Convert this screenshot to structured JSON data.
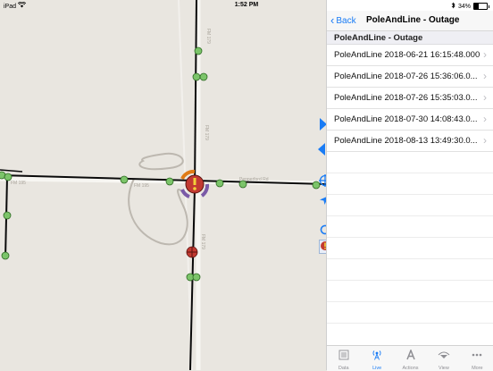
{
  "status_bar": {
    "device": "iPad",
    "time": "1:52 PM",
    "battery": "34%"
  },
  "map": {
    "road_labels": [
      "FM 179",
      "FM 179",
      "FM 179",
      "FM 195",
      "FM 195",
      "Pepperford Rd"
    ]
  },
  "panel": {
    "back_label": "Back",
    "title": "PoleAndLine - Outage",
    "section_header": "PoleAndLine - Outage",
    "items": [
      {
        "label": "PoleAndLine 2018-06-21 16:15:48.000"
      },
      {
        "label": "PoleAndLine 2018-07-26 15:36:06.0..."
      },
      {
        "label": "PoleAndLine 2018-07-26 15:35:03.0..."
      },
      {
        "label": "PoleAndLine 2018-07-30 14:08:43.0..."
      },
      {
        "label": "PoleAndLine 2018-08-13 13:49:30.0..."
      }
    ],
    "chevron": "›"
  },
  "tabs": [
    {
      "label": "Data",
      "icon": "data-list-icon",
      "active": false
    },
    {
      "label": "Live",
      "icon": "live-antenna-icon",
      "active": true
    },
    {
      "label": "Actions",
      "icon": "actions-a-icon",
      "active": false
    },
    {
      "label": "View",
      "icon": "view-eye-icon",
      "active": false
    },
    {
      "label": "More",
      "icon": "more-dots-icon",
      "active": false
    }
  ],
  "colors": {
    "accent": "#1a7cf5",
    "line": "#0a0a0a",
    "pole_green": "#7cc46a",
    "pole_red": "#c23a32",
    "outage_orange": "#e07b16",
    "outage_purple": "#7a5aa7"
  }
}
